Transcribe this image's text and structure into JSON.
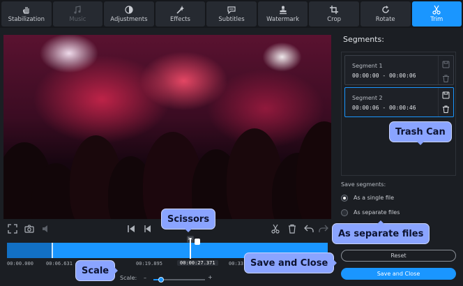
{
  "toolbar": {
    "tools": [
      {
        "label": "Stabilization",
        "icon": "hand-stabilization-icon"
      },
      {
        "label": "Music",
        "icon": "music-note-icon"
      },
      {
        "label": "Adjustments",
        "icon": "contrast-icon"
      },
      {
        "label": "Effects",
        "icon": "magic-wand-icon"
      },
      {
        "label": "Subtitles",
        "icon": "speech-bubble-icon"
      },
      {
        "label": "Watermark",
        "icon": "stamp-icon"
      },
      {
        "label": "Crop",
        "icon": "crop-icon"
      },
      {
        "label": "Rotate",
        "icon": "rotate-icon"
      },
      {
        "label": "Trim",
        "icon": "scissors-icon"
      }
    ],
    "active_tool": "Trim",
    "disabled_tool": "Music"
  },
  "timeline": {
    "ticks": [
      "00:00.000",
      "00:06.631",
      "00:19.895",
      "00:00:27.371",
      "00:33"
    ],
    "current_time": "00:00:27.371"
  },
  "scale": {
    "label": "Scale:",
    "minus": "–",
    "plus": "+",
    "level": 0.15
  },
  "segments_panel": {
    "title": "Segments:",
    "segments": [
      {
        "name": "Segment 1",
        "range": "00:00:00 - 00:00:06",
        "active": false
      },
      {
        "name": "Segment 2",
        "range": "00:00:06 - 00:00:46",
        "active": true
      }
    ]
  },
  "save_segments": {
    "label": "Save segments:",
    "options": [
      "As a single file",
      "As separate files"
    ],
    "selected": "As a single file"
  },
  "buttons": {
    "reset": "Reset",
    "save_close": "Save and Close"
  },
  "callouts": {
    "trash_can": "Trash Can",
    "scissors": "Scissors",
    "as_separate_files": "As separate files",
    "save_and_close": "Save and Close",
    "scale": "Scale"
  },
  "colors": {
    "accent": "#1a96ff",
    "callout": "#8aa4ff",
    "background": "#1b1e23"
  }
}
